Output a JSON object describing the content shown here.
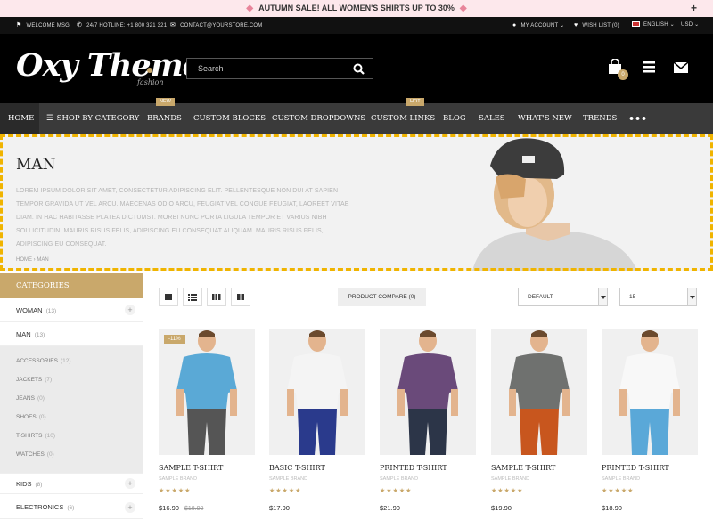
{
  "promo": {
    "text": "AUTUMN SALE! ALL WOMEN'S SHIRTS UP TO 30%",
    "close": "+"
  },
  "topbar": {
    "welcome": "WELCOME MSG",
    "hotline": "24/7 HOTLINE: +1 800 321 321",
    "contact": "CONTACT@YOURSTORE.COM",
    "account": "MY ACCOUNT",
    "wishlist": "WISH LIST (0)",
    "language": "ENGLISH",
    "currency": "USD"
  },
  "header": {
    "logo": "Oxy Theme",
    "logo_tag": "fashion",
    "search_placeholder": "Search",
    "cart_count": "0"
  },
  "nav": {
    "items": [
      {
        "label": "HOME"
      },
      {
        "label": "SHOP BY CATEGORY"
      },
      {
        "label": "BRANDS",
        "badge": "NEW"
      },
      {
        "label": "CUSTOM BLOCKS"
      },
      {
        "label": "CUSTOM DROPDOWNS"
      },
      {
        "label": "CUSTOM LINKS",
        "badge": "HOT"
      },
      {
        "label": "BLOG"
      },
      {
        "label": "SALES"
      },
      {
        "label": "WHAT'S NEW"
      },
      {
        "label": "TRENDS"
      }
    ],
    "more": "•••"
  },
  "banner": {
    "title": "MAN",
    "description": "LOREM IPSUM DOLOR SIT AMET, CONSECTETUR ADIPISCING ELIT. PELLENTESQUE NON DUI AT SAPIEN TEMPOR GRAVIDA UT VEL ARCU. MAECENAS ODIO ARCU, FEUGIAT VEL CONGUE FEUGIAT, LAOREET VITAE DIAM. IN HAC HABITASSE PLATEA DICTUMST. MORBI NUNC PORTA LIGULA TEMPOR ET VARIUS NIBH SOLLICITUDIN. MAURIS RISUS FELIS, ADIPISCING EU CONSEQUAT ALIQUAM. MAURIS RISUS FELIS, ADIPISCING EU CONSEQUAT.",
    "breadcrumb": [
      "HOME",
      "MAN"
    ]
  },
  "sidebar": {
    "title": "CATEGORIES",
    "top": [
      {
        "label": "WOMAN",
        "count": "(13)",
        "expand": "+"
      },
      {
        "label": "MAN",
        "count": "(13)"
      }
    ],
    "sub": [
      {
        "label": "ACCESSORIES",
        "count": "(12)"
      },
      {
        "label": "JACKETS",
        "count": "(7)"
      },
      {
        "label": "JEANS",
        "count": "(0)"
      },
      {
        "label": "SHOES",
        "count": "(0)"
      },
      {
        "label": "T-SHIRTS",
        "count": "(10)"
      },
      {
        "label": "WATCHES",
        "count": "(0)"
      }
    ],
    "bottom": [
      {
        "label": "KIDS",
        "count": "(8)",
        "expand": "+"
      },
      {
        "label": "ELECTRONICS",
        "count": "(6)",
        "expand": "+"
      }
    ]
  },
  "toolbar": {
    "compare": "PRODUCT COMPARE (0)",
    "sort": "DEFAULT",
    "limit": "15"
  },
  "products": [
    {
      "name": "SAMPLE T-SHIRT",
      "brand": "SAMPLE BRAND",
      "price": "$16.90",
      "old_price": "$18.90",
      "sale": "-11%",
      "shirt": "#5aa9d6",
      "pants": "#555555"
    },
    {
      "name": "BASIC T-SHIRT",
      "brand": "SAMPLE BRAND",
      "price": "$17.90",
      "shirt": "#f4f4f4",
      "pants": "#2a3a8c"
    },
    {
      "name": "PRINTED T-SHIRT",
      "brand": "SAMPLE BRAND",
      "price": "$21.90",
      "shirt": "#6a4a7a",
      "pants": "#2c3548"
    },
    {
      "name": "SAMPLE T-SHIRT",
      "brand": "SAMPLE BRAND",
      "price": "$19.90",
      "shirt": "#6f716f",
      "pants": "#c8561e"
    },
    {
      "name": "PRINTED T-SHIRT",
      "brand": "SAMPLE BRAND",
      "price": "$18.90",
      "shirt": "#f8f8f8",
      "pants": "#5aa8d8"
    }
  ],
  "stars": "★★★★★",
  "colors": {
    "accent": "#c9a86b",
    "dark": "#000000",
    "nav": "#3a3a3a",
    "highlight": "#f0b400"
  }
}
